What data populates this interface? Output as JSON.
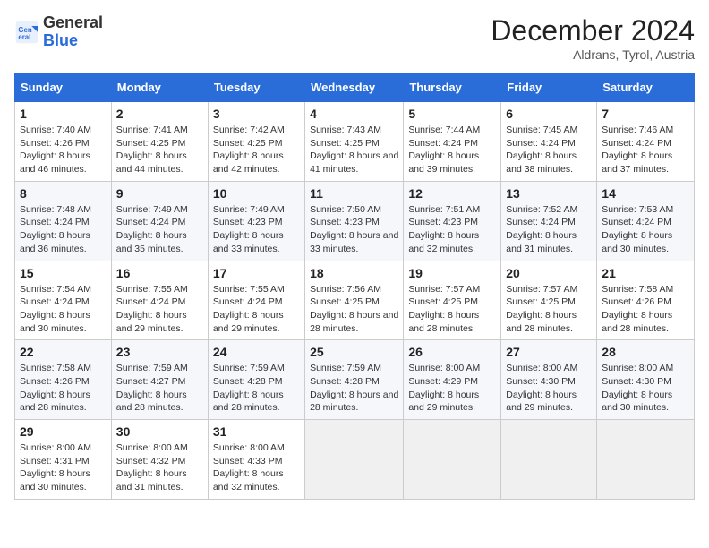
{
  "header": {
    "logo_general": "General",
    "logo_blue": "Blue",
    "month_title": "December 2024",
    "location": "Aldrans, Tyrol, Austria"
  },
  "days_of_week": [
    "Sunday",
    "Monday",
    "Tuesday",
    "Wednesday",
    "Thursday",
    "Friday",
    "Saturday"
  ],
  "weeks": [
    [
      {
        "day": "1",
        "sunrise": "7:40 AM",
        "sunset": "4:26 PM",
        "daylight": "8 hours and 46 minutes."
      },
      {
        "day": "2",
        "sunrise": "7:41 AM",
        "sunset": "4:25 PM",
        "daylight": "8 hours and 44 minutes."
      },
      {
        "day": "3",
        "sunrise": "7:42 AM",
        "sunset": "4:25 PM",
        "daylight": "8 hours and 42 minutes."
      },
      {
        "day": "4",
        "sunrise": "7:43 AM",
        "sunset": "4:25 PM",
        "daylight": "8 hours and 41 minutes."
      },
      {
        "day": "5",
        "sunrise": "7:44 AM",
        "sunset": "4:24 PM",
        "daylight": "8 hours and 39 minutes."
      },
      {
        "day": "6",
        "sunrise": "7:45 AM",
        "sunset": "4:24 PM",
        "daylight": "8 hours and 38 minutes."
      },
      {
        "day": "7",
        "sunrise": "7:46 AM",
        "sunset": "4:24 PM",
        "daylight": "8 hours and 37 minutes."
      }
    ],
    [
      {
        "day": "8",
        "sunrise": "7:48 AM",
        "sunset": "4:24 PM",
        "daylight": "8 hours and 36 minutes."
      },
      {
        "day": "9",
        "sunrise": "7:49 AM",
        "sunset": "4:24 PM",
        "daylight": "8 hours and 35 minutes."
      },
      {
        "day": "10",
        "sunrise": "7:49 AM",
        "sunset": "4:23 PM",
        "daylight": "8 hours and 33 minutes."
      },
      {
        "day": "11",
        "sunrise": "7:50 AM",
        "sunset": "4:23 PM",
        "daylight": "8 hours and 33 minutes."
      },
      {
        "day": "12",
        "sunrise": "7:51 AM",
        "sunset": "4:23 PM",
        "daylight": "8 hours and 32 minutes."
      },
      {
        "day": "13",
        "sunrise": "7:52 AM",
        "sunset": "4:24 PM",
        "daylight": "8 hours and 31 minutes."
      },
      {
        "day": "14",
        "sunrise": "7:53 AM",
        "sunset": "4:24 PM",
        "daylight": "8 hours and 30 minutes."
      }
    ],
    [
      {
        "day": "15",
        "sunrise": "7:54 AM",
        "sunset": "4:24 PM",
        "daylight": "8 hours and 30 minutes."
      },
      {
        "day": "16",
        "sunrise": "7:55 AM",
        "sunset": "4:24 PM",
        "daylight": "8 hours and 29 minutes."
      },
      {
        "day": "17",
        "sunrise": "7:55 AM",
        "sunset": "4:24 PM",
        "daylight": "8 hours and 29 minutes."
      },
      {
        "day": "18",
        "sunrise": "7:56 AM",
        "sunset": "4:25 PM",
        "daylight": "8 hours and 28 minutes."
      },
      {
        "day": "19",
        "sunrise": "7:57 AM",
        "sunset": "4:25 PM",
        "daylight": "8 hours and 28 minutes."
      },
      {
        "day": "20",
        "sunrise": "7:57 AM",
        "sunset": "4:25 PM",
        "daylight": "8 hours and 28 minutes."
      },
      {
        "day": "21",
        "sunrise": "7:58 AM",
        "sunset": "4:26 PM",
        "daylight": "8 hours and 28 minutes."
      }
    ],
    [
      {
        "day": "22",
        "sunrise": "7:58 AM",
        "sunset": "4:26 PM",
        "daylight": "8 hours and 28 minutes."
      },
      {
        "day": "23",
        "sunrise": "7:59 AM",
        "sunset": "4:27 PM",
        "daylight": "8 hours and 28 minutes."
      },
      {
        "day": "24",
        "sunrise": "7:59 AM",
        "sunset": "4:28 PM",
        "daylight": "8 hours and 28 minutes."
      },
      {
        "day": "25",
        "sunrise": "7:59 AM",
        "sunset": "4:28 PM",
        "daylight": "8 hours and 28 minutes."
      },
      {
        "day": "26",
        "sunrise": "8:00 AM",
        "sunset": "4:29 PM",
        "daylight": "8 hours and 29 minutes."
      },
      {
        "day": "27",
        "sunrise": "8:00 AM",
        "sunset": "4:30 PM",
        "daylight": "8 hours and 29 minutes."
      },
      {
        "day": "28",
        "sunrise": "8:00 AM",
        "sunset": "4:30 PM",
        "daylight": "8 hours and 30 minutes."
      }
    ],
    [
      {
        "day": "29",
        "sunrise": "8:00 AM",
        "sunset": "4:31 PM",
        "daylight": "8 hours and 30 minutes."
      },
      {
        "day": "30",
        "sunrise": "8:00 AM",
        "sunset": "4:32 PM",
        "daylight": "8 hours and 31 minutes."
      },
      {
        "day": "31",
        "sunrise": "8:00 AM",
        "sunset": "4:33 PM",
        "daylight": "8 hours and 32 minutes."
      },
      null,
      null,
      null,
      null
    ]
  ],
  "labels": {
    "sunrise": "Sunrise:",
    "sunset": "Sunset:",
    "daylight": "Daylight:"
  }
}
